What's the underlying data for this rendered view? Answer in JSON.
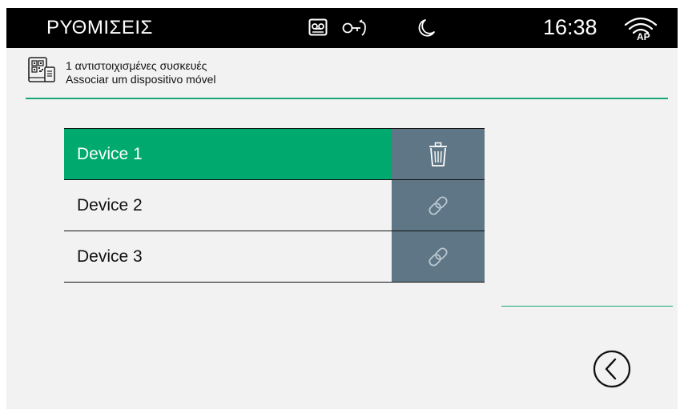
{
  "header": {
    "title": "ΡΥΘΜΙΣΕΙΣ",
    "time": "16:38",
    "icons": [
      "voicemail-icon",
      "door-key-icon",
      "do-not-disturb-moon-icon",
      "wifi-ap-icon"
    ],
    "wifi_badge": "AP"
  },
  "subheader": {
    "icon": "qr-mobile-icon",
    "paired_count_text": "1 αντιστοιχισμένες συσκευές",
    "pair_action_text": "Associar um dispositivo móvel"
  },
  "devices": [
    {
      "name": "Device 1",
      "paired": true,
      "action_icon": "trash-icon"
    },
    {
      "name": "Device 2",
      "paired": false,
      "action_icon": "link-icon"
    },
    {
      "name": "Device 3",
      "paired": false,
      "action_icon": "link-icon"
    }
  ],
  "footer": {
    "back_icon": "chevron-left-circle-icon"
  },
  "colors": {
    "accent_green": "#00aa6e",
    "action_slate": "#5e7685",
    "topbar": "#000000",
    "background": "#f2f2f2"
  }
}
